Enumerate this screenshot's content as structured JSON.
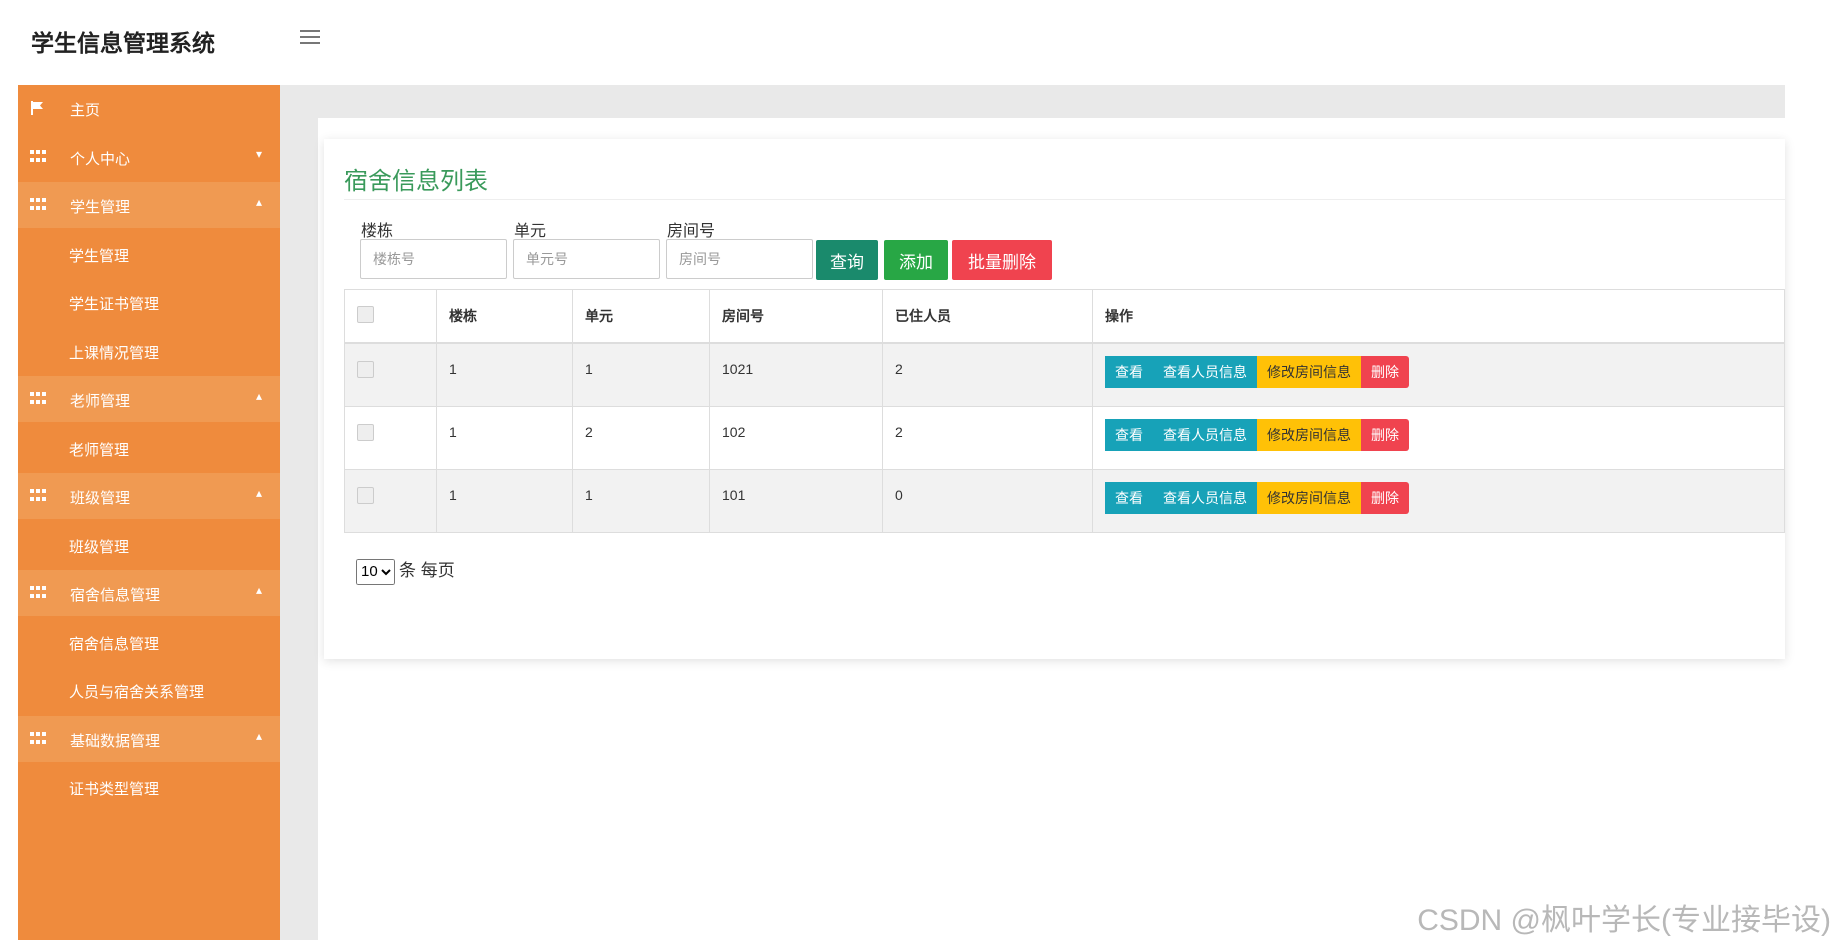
{
  "app": {
    "title": "学生信息管理系统"
  },
  "sidebar": {
    "items": [
      {
        "label": "主页",
        "type": "head",
        "icon": "flag-icon"
      },
      {
        "label": "个人中心",
        "type": "head",
        "icon": "grid-icon",
        "caret": "▾"
      },
      {
        "label": "学生管理",
        "type": "open",
        "icon": "grid-icon",
        "caret": "▴"
      },
      {
        "label": "学生管理",
        "type": "sub"
      },
      {
        "label": "学生证书管理",
        "type": "sub"
      },
      {
        "label": "上课情况管理",
        "type": "sub"
      },
      {
        "label": "老师管理",
        "type": "open",
        "icon": "grid-icon",
        "caret": "▴"
      },
      {
        "label": "老师管理",
        "type": "sub"
      },
      {
        "label": "班级管理",
        "type": "open",
        "icon": "grid-icon",
        "caret": "▴"
      },
      {
        "label": "班级管理",
        "type": "sub"
      },
      {
        "label": "宿舍信息管理",
        "type": "open",
        "icon": "grid-icon",
        "caret": "▴"
      },
      {
        "label": "宿舍信息管理",
        "type": "sub"
      },
      {
        "label": "人员与宿舍关系管理",
        "type": "sub"
      },
      {
        "label": "基础数据管理",
        "type": "open",
        "icon": "grid-icon",
        "caret": "▴"
      },
      {
        "label": "证书类型管理",
        "type": "sub"
      }
    ]
  },
  "page": {
    "title": "宿舍信息列表",
    "filters": {
      "building": {
        "label": "楼栋",
        "placeholder": "楼栋号"
      },
      "unit": {
        "label": "单元",
        "placeholder": "单元号"
      },
      "room": {
        "label": "房间号",
        "placeholder": "房间号"
      }
    },
    "buttons": {
      "search": "查询",
      "add": "添加",
      "batch_delete": "批量删除"
    },
    "table": {
      "headers": [
        "楼栋",
        "单元",
        "房间号",
        "已住人员",
        "操作"
      ],
      "rows": [
        {
          "building": "1",
          "unit": "1",
          "room": "1021",
          "residents": "2"
        },
        {
          "building": "1",
          "unit": "2",
          "room": "102",
          "residents": "2"
        },
        {
          "building": "1",
          "unit": "1",
          "room": "101",
          "residents": "0"
        }
      ],
      "actions": {
        "view": "查看",
        "view_people": "查看人员信息",
        "edit_room": "修改房间信息",
        "delete": "删除"
      }
    },
    "pager": {
      "page_size": "10",
      "suffix": "条 每页"
    }
  },
  "watermark": "CSDN @枫叶学长(专业接毕设)",
  "colors": {
    "sidebar": "#ef8b3d",
    "accent_title": "#3a9a5b",
    "info": "#17a2b8",
    "warning": "#ffc107",
    "danger": "#f0434f"
  }
}
